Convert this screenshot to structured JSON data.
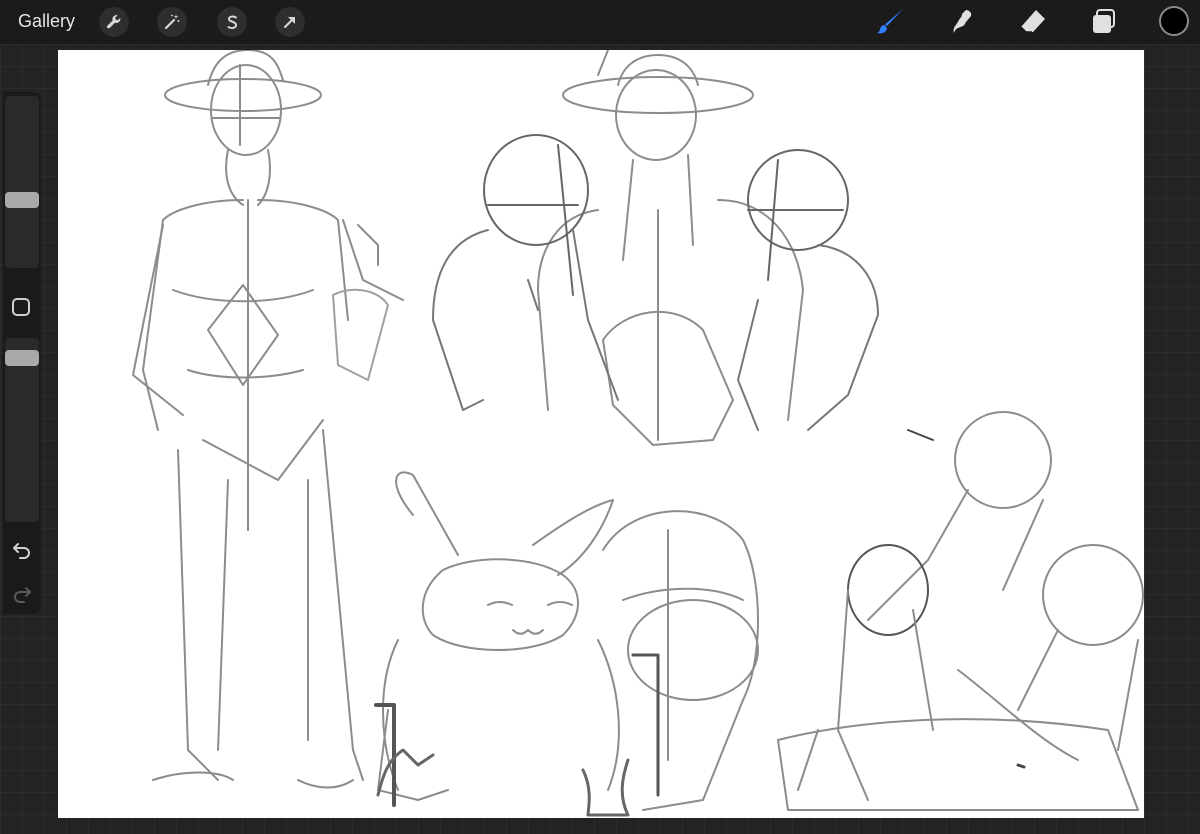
{
  "topbar": {
    "gallery_label": "Gallery",
    "left_tools": [
      "wrench-icon",
      "magic-wand-icon",
      "selection-s-icon",
      "transform-arrow-icon"
    ],
    "right_tools": [
      "brush-icon",
      "smudge-icon",
      "eraser-icon",
      "layers-icon"
    ],
    "active_tool": "brush-icon",
    "accent_color": "#2f7fff",
    "current_color": "#000000"
  },
  "sidebar": {
    "controls": [
      "brush-size-slider",
      "modify-square-button",
      "opacity-slider",
      "undo-icon",
      "redo-icon"
    ]
  },
  "colors": {
    "background": "#232323",
    "toolbar": "#1b1b1b",
    "canvas": "#ffffff",
    "sketch_stroke": "#8c8c8c",
    "sketch_dark": "#555555"
  }
}
